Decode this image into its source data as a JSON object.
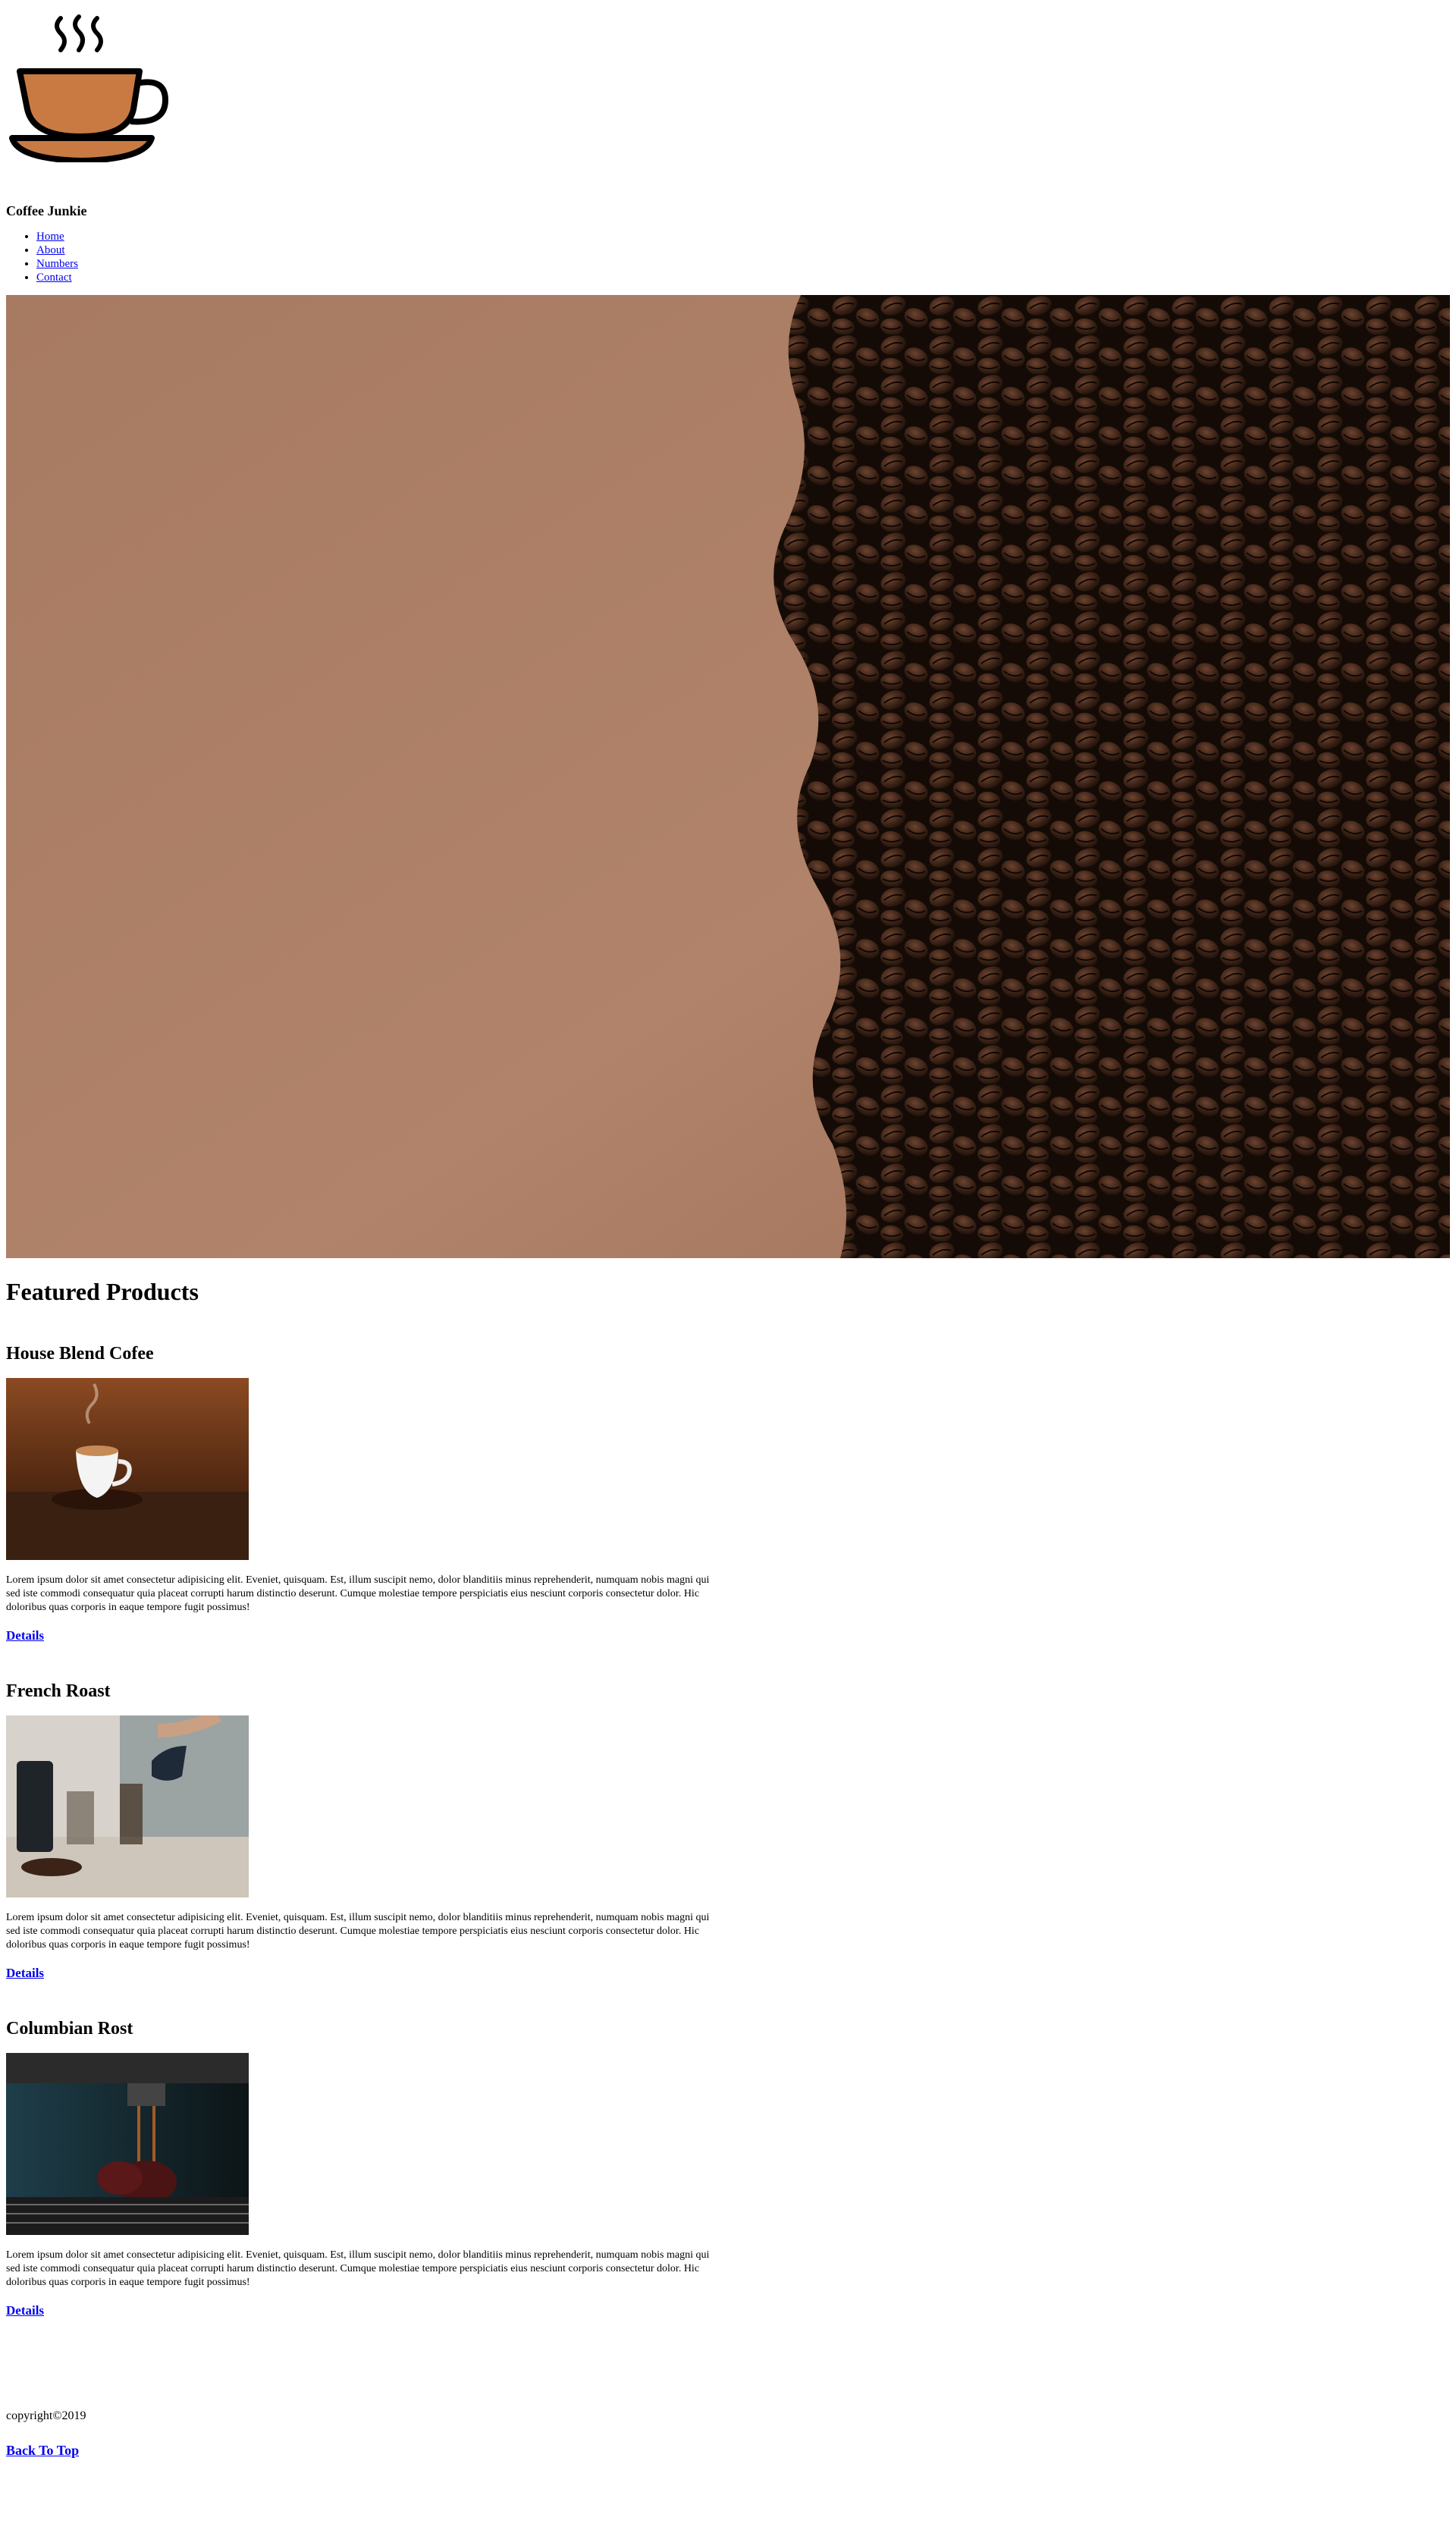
{
  "site": {
    "brand": "Coffee Junkie"
  },
  "nav": {
    "items": [
      {
        "label": "Home"
      },
      {
        "label": "About"
      },
      {
        "label": "Numbers"
      },
      {
        "label": "Contact"
      }
    ]
  },
  "main": {
    "featured_heading": "Featured Products",
    "products": [
      {
        "title": "House Blend Cofee",
        "description": "Lorem ipsum dolor sit amet consectetur adipisicing elit. Eveniet, quisquam. Est, illum suscipit nemo, dolor blanditiis minus reprehenderit, numquam nobis magni qui sed iste commodi consequatur quia placeat corrupti harum distinctio deserunt. Cumque molestiae tempore perspiciatis eius nesciunt corporis consectetur dolor. Hic doloribus quas corporis in eaque tempore fugit possimus!",
        "link": "Details"
      },
      {
        "title": "French Roast",
        "description": "Lorem ipsum dolor sit amet consectetur adipisicing elit. Eveniet, quisquam. Est, illum suscipit nemo, dolor blanditiis minus reprehenderit, numquam nobis magni qui sed iste commodi consequatur quia placeat corrupti harum distinctio deserunt. Cumque molestiae tempore perspiciatis eius nesciunt corporis consectetur dolor. Hic doloribus quas corporis in eaque tempore fugit possimus!",
        "link": "Details"
      },
      {
        "title": "Columbian Rost",
        "description": "Lorem ipsum dolor sit amet consectetur adipisicing elit. Eveniet, quisquam. Est, illum suscipit nemo, dolor blanditiis minus reprehenderit, numquam nobis magni qui sed iste commodi consequatur quia placeat corrupti harum distinctio deserunt. Cumque molestiae tempore perspiciatis eius nesciunt corporis consectetur dolor. Hic doloribus quas corporis in eaque tempore fugit possimus!",
        "link": "Details"
      }
    ]
  },
  "footer": {
    "copyright": "copyright©2019",
    "back_to_top": "Back To Top"
  },
  "colors": {
    "link": "#0000ee",
    "hero_background": "#a87961",
    "bean": "#3b2216",
    "cup_fill": "#c97a43"
  },
  "icons": {
    "logo": "coffee-cup-icon"
  }
}
